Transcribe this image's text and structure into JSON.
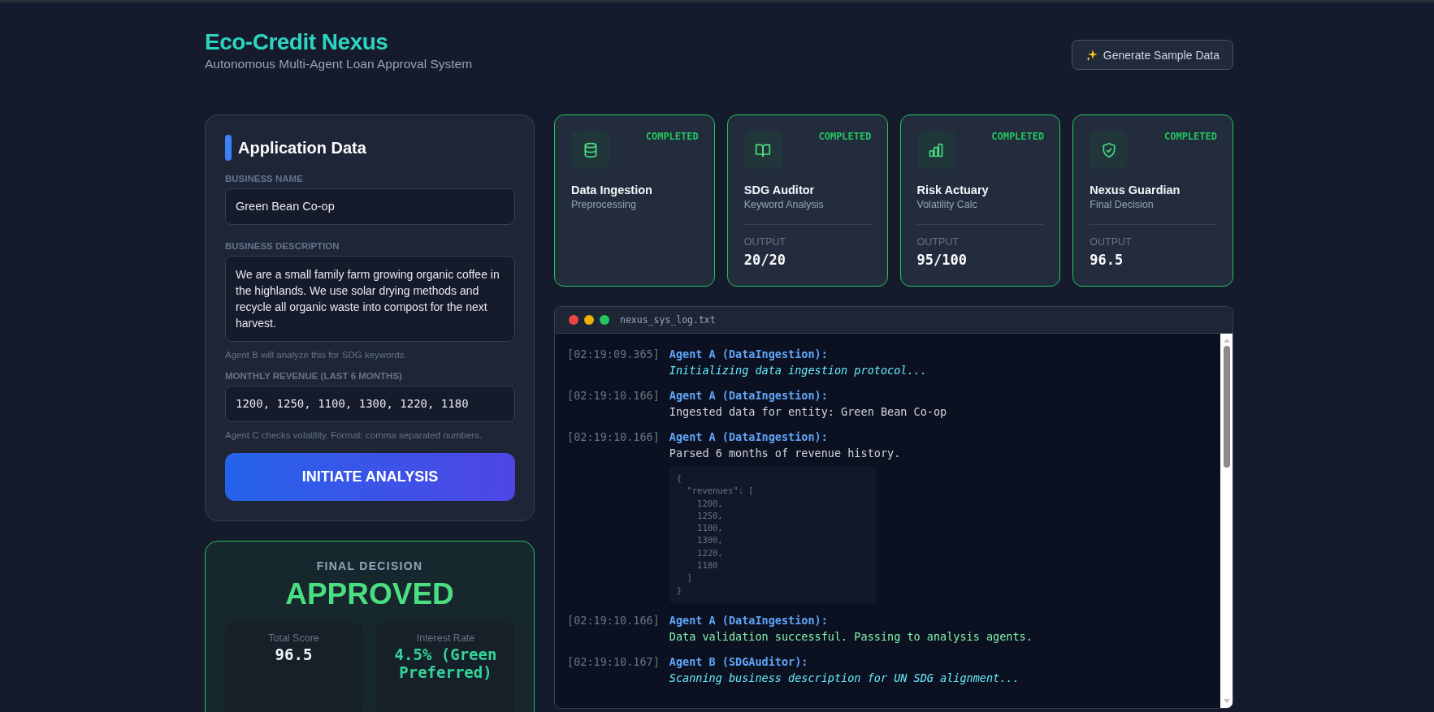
{
  "header": {
    "title": "Eco-Credit Nexus",
    "subtitle": "Autonomous Multi-Agent Loan Approval System",
    "sample_button": "Generate Sample Data"
  },
  "application": {
    "title": "Application Data",
    "fields": [
      {
        "kind": "text",
        "label": "BUSINESS NAME",
        "value": "Green Bean Co-op"
      },
      {
        "kind": "textarea",
        "label": "BUSINESS DESCRIPTION",
        "value": "We are a small family farm growing organic coffee in the highlands. We use solar drying methods and recycle all organic waste into compost for the next harvest.",
        "hint": "Agent B will analyze this for SDG keywords."
      },
      {
        "kind": "mono",
        "label": "MONTHLY REVENUE (LAST 6 MONTHS)",
        "value": "1200, 1250, 1100, 1300, 1220, 1180",
        "hint": "Agent C checks volatility. Format: comma separated numbers."
      }
    ],
    "submit": "INITIATE ANALYSIS"
  },
  "decision": {
    "label": "FINAL DECISION",
    "verdict": "APPROVED",
    "approved": true,
    "stats": [
      {
        "label": "Total Score",
        "value": "96.5",
        "kind": "plain"
      },
      {
        "label": "Interest Rate",
        "value": "4.5% (Green Preferred)",
        "kind": "accent"
      }
    ]
  },
  "agents": [
    {
      "name": "Data Ingestion",
      "role": "Preprocessing",
      "status": "COMPLETED",
      "done": true
    },
    {
      "name": "SDG Auditor",
      "role": "Keyword Analysis",
      "status": "COMPLETED",
      "done": true,
      "output_label": "OUTPUT",
      "output": "20/20"
    },
    {
      "name": "Risk Actuary",
      "role": "Volatility Calc",
      "status": "COMPLETED",
      "done": true,
      "output_label": "OUTPUT",
      "output": "95/100"
    },
    {
      "name": "Nexus Guardian",
      "role": "Final Decision",
      "status": "COMPLETED",
      "done": true,
      "output_label": "OUTPUT",
      "output": "96.5"
    }
  ],
  "log": {
    "filename": "nexus_sys_log.txt",
    "entries": [
      {
        "time": "[02:19:09.365]",
        "agent": "Agent A (DataIngestion):",
        "message": "Initializing data ingestion protocol...",
        "kind": "info"
      },
      {
        "time": "[02:19:10.166]",
        "agent": "Agent A (DataIngestion):",
        "message": "Ingested data for entity: Green Bean Co-op",
        "kind": "plain"
      },
      {
        "time": "[02:19:10.166]",
        "agent": "Agent A (DataIngestion):",
        "message": "Parsed 6 months of revenue history.",
        "kind": "plain",
        "code": "{\n  \"revenues\": [\n    1200,\n    1250,\n    1100,\n    1300,\n    1220,\n    1180\n  ]\n}"
      },
      {
        "time": "[02:19:10.166]",
        "agent": "Agent A (DataIngestion):",
        "message": "Data validation successful. Passing to analysis agents.",
        "kind": "success"
      },
      {
        "time": "[02:19:10.167]",
        "agent": "Agent B (SDGAuditor):",
        "message": "Scanning business description for UN SDG alignment...",
        "kind": "info"
      }
    ]
  }
}
